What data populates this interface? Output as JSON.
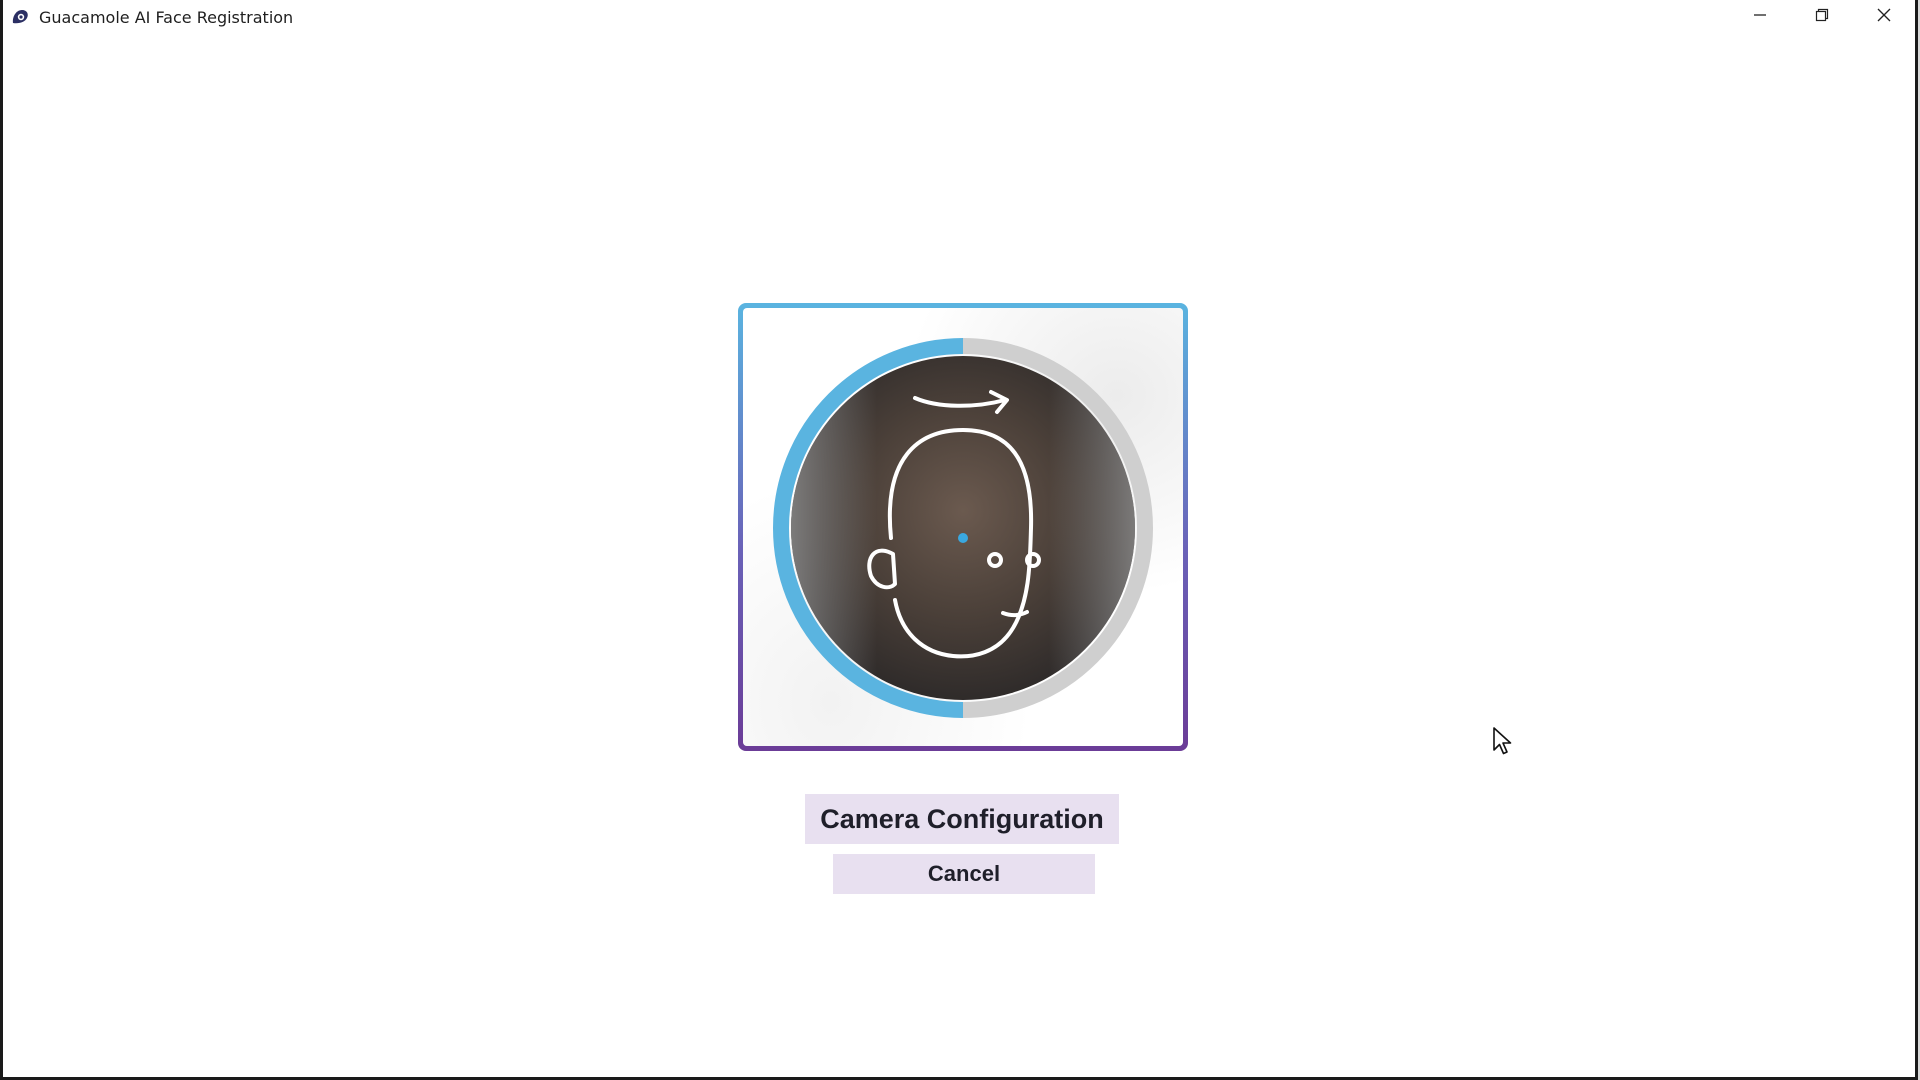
{
  "window": {
    "title": "Guacamole AI Face Registration",
    "icon": "guacamole-app-icon",
    "controls": {
      "minimize_icon": "minimize-icon",
      "restore_icon": "restore-icon",
      "close_icon": "close-icon"
    }
  },
  "camera": {
    "frame_gradient": [
      "#5ab4e0",
      "#6b3c97"
    ],
    "progress_ring": {
      "progress_fraction": 0.5,
      "progress_color": "#5ab4e0",
      "track_color": "#cfcfcf"
    },
    "guide_icon": "head-turn-right-icon",
    "center_dot_color": "#3aa8e0"
  },
  "buttons": {
    "camera_configuration": "Camera Configuration",
    "cancel": "Cancel"
  },
  "colors": {
    "button_bg": "#e8e0f0",
    "button_text": "#1f1f2a"
  }
}
